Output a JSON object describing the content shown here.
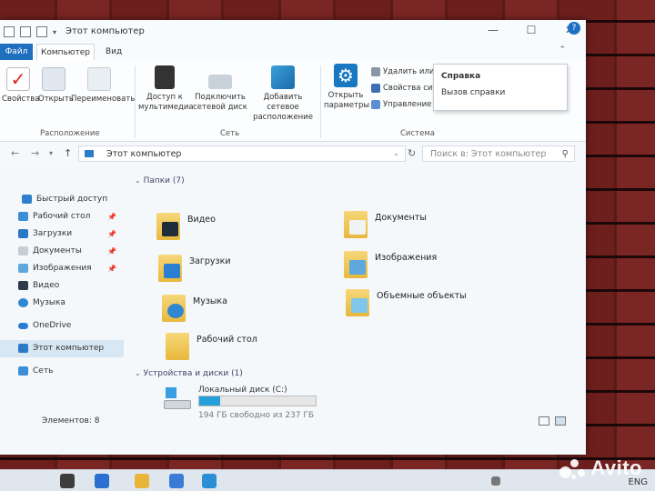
{
  "window": {
    "title": "Этот компьютер",
    "tabs": {
      "file": "Файл",
      "computer": "Компьютер",
      "view": "Вид"
    }
  },
  "ribbon": {
    "location": {
      "properties": "Свойства",
      "open": "Открыть",
      "rename": "Переименовать",
      "label": "Расположение"
    },
    "network": {
      "media_line1": "Доступ к",
      "media_line2": "мультимедиа",
      "map_line1": "Подключить",
      "map_line2": "сетевой диск",
      "add_line1": "Добавить сетевое",
      "add_line2": "расположение",
      "label": "Сеть"
    },
    "system": {
      "open_line1": "Открыть",
      "open_line2": "параметры",
      "uninstall": "Удалить или и",
      "props": "Свойства сист",
      "manage": "Управление",
      "label": "Система"
    },
    "help_popup": {
      "title": "Справка",
      "item": "Вызов справки"
    }
  },
  "address": {
    "path": "Этот компьютер",
    "search_placeholder": "Поиск в: Этот компьютер"
  },
  "nav": {
    "quick_access": "Быстрый доступ",
    "items": [
      "Рабочий стол",
      "Загрузки",
      "Документы",
      "Изображения",
      "Видео",
      "Музыка"
    ],
    "onedrive": "OneDrive",
    "this_pc": "Этот компьютер",
    "network": "Сеть"
  },
  "content": {
    "folders_header": "Папки (7)",
    "folders": [
      "Видео",
      "Документы",
      "Загрузки",
      "Изображения",
      "Музыка",
      "Объемные объекты",
      "Рабочий стол"
    ],
    "devices_header": "Устройства и диски (1)",
    "drive": {
      "name": "Локальный диск (C:)",
      "free_text": "194 ГБ свободно из 237 ГБ",
      "used_fraction": 0.18
    }
  },
  "status": {
    "items": "Элементов: 8"
  },
  "taskbar": {
    "lang": "ENG"
  },
  "watermark": "Avito",
  "colors": {
    "accent": "#1f6fbf",
    "drive_bar": "#26a0da",
    "brick": "#6d1f1d"
  }
}
